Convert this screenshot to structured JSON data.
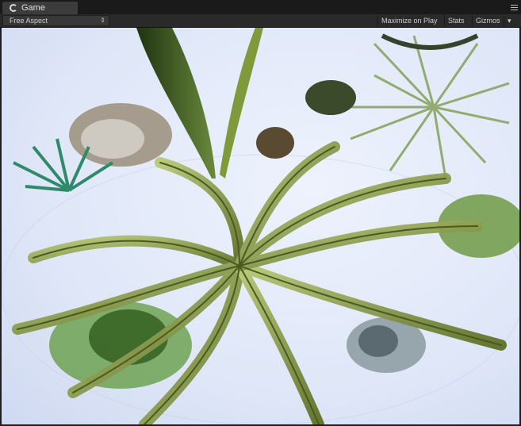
{
  "window": {
    "tab_title": "Game"
  },
  "toolbar": {
    "aspect": "Free Aspect",
    "maximize_on_play": "Maximize on Play",
    "stats": "Stats",
    "gizmos": "Gizmos"
  },
  "icons": {
    "tab": "game-controller-icon",
    "menu": "tab-menu-icon",
    "aspect_arrows": "updown-arrows-icon",
    "gizmos_arrow": "dropdown-arrow-icon"
  },
  "colors": {
    "sky": "#e3e9fa",
    "fern": "#8a9a48",
    "dark_leaf": "#2f4a1d",
    "toolbar": "#2a2a2a"
  }
}
